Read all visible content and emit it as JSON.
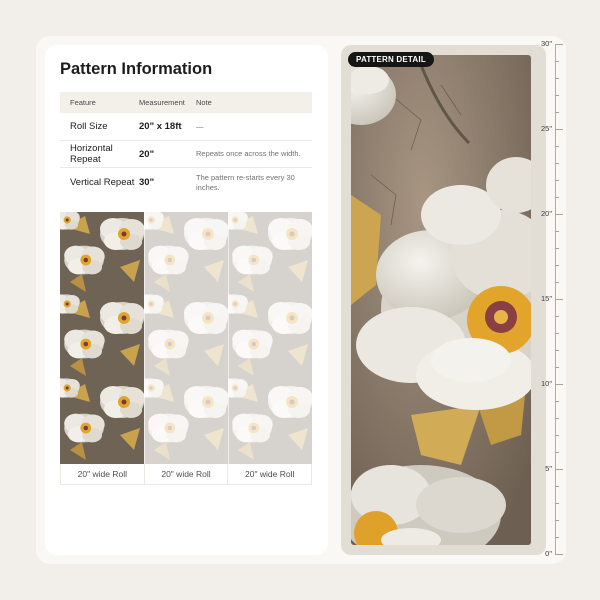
{
  "info": {
    "title": "Pattern Information",
    "table": {
      "headers": [
        "Feature",
        "Measurement",
        "Note"
      ],
      "rows": [
        {
          "feature": "Roll Size",
          "measurement": "20\" x 18ft",
          "note": "—"
        },
        {
          "feature": "Horizontal Repeat",
          "measurement": "20\"",
          "note": "Repeats once across the width."
        },
        {
          "feature": "Vertical Repeat",
          "measurement": "30\"",
          "note": "The pattern re-starts every 30 inches."
        }
      ]
    },
    "rolls": [
      "20\" wide Roll",
      "20\" wide Roll",
      "20\" wide Roll"
    ]
  },
  "detail": {
    "badge": "PATTERN DETAIL"
  },
  "ruler": {
    "labels": [
      "30\"",
      "25\"",
      "20\"",
      "15\"",
      "10\"",
      "5\"",
      "0\""
    ]
  },
  "colors": {
    "background": "#f2efea",
    "badge": "#151515",
    "petal": "#e9e5dc",
    "stamen": "#e1a52b",
    "gold_leaf": "#cda550",
    "wall": "#8c7a66"
  }
}
